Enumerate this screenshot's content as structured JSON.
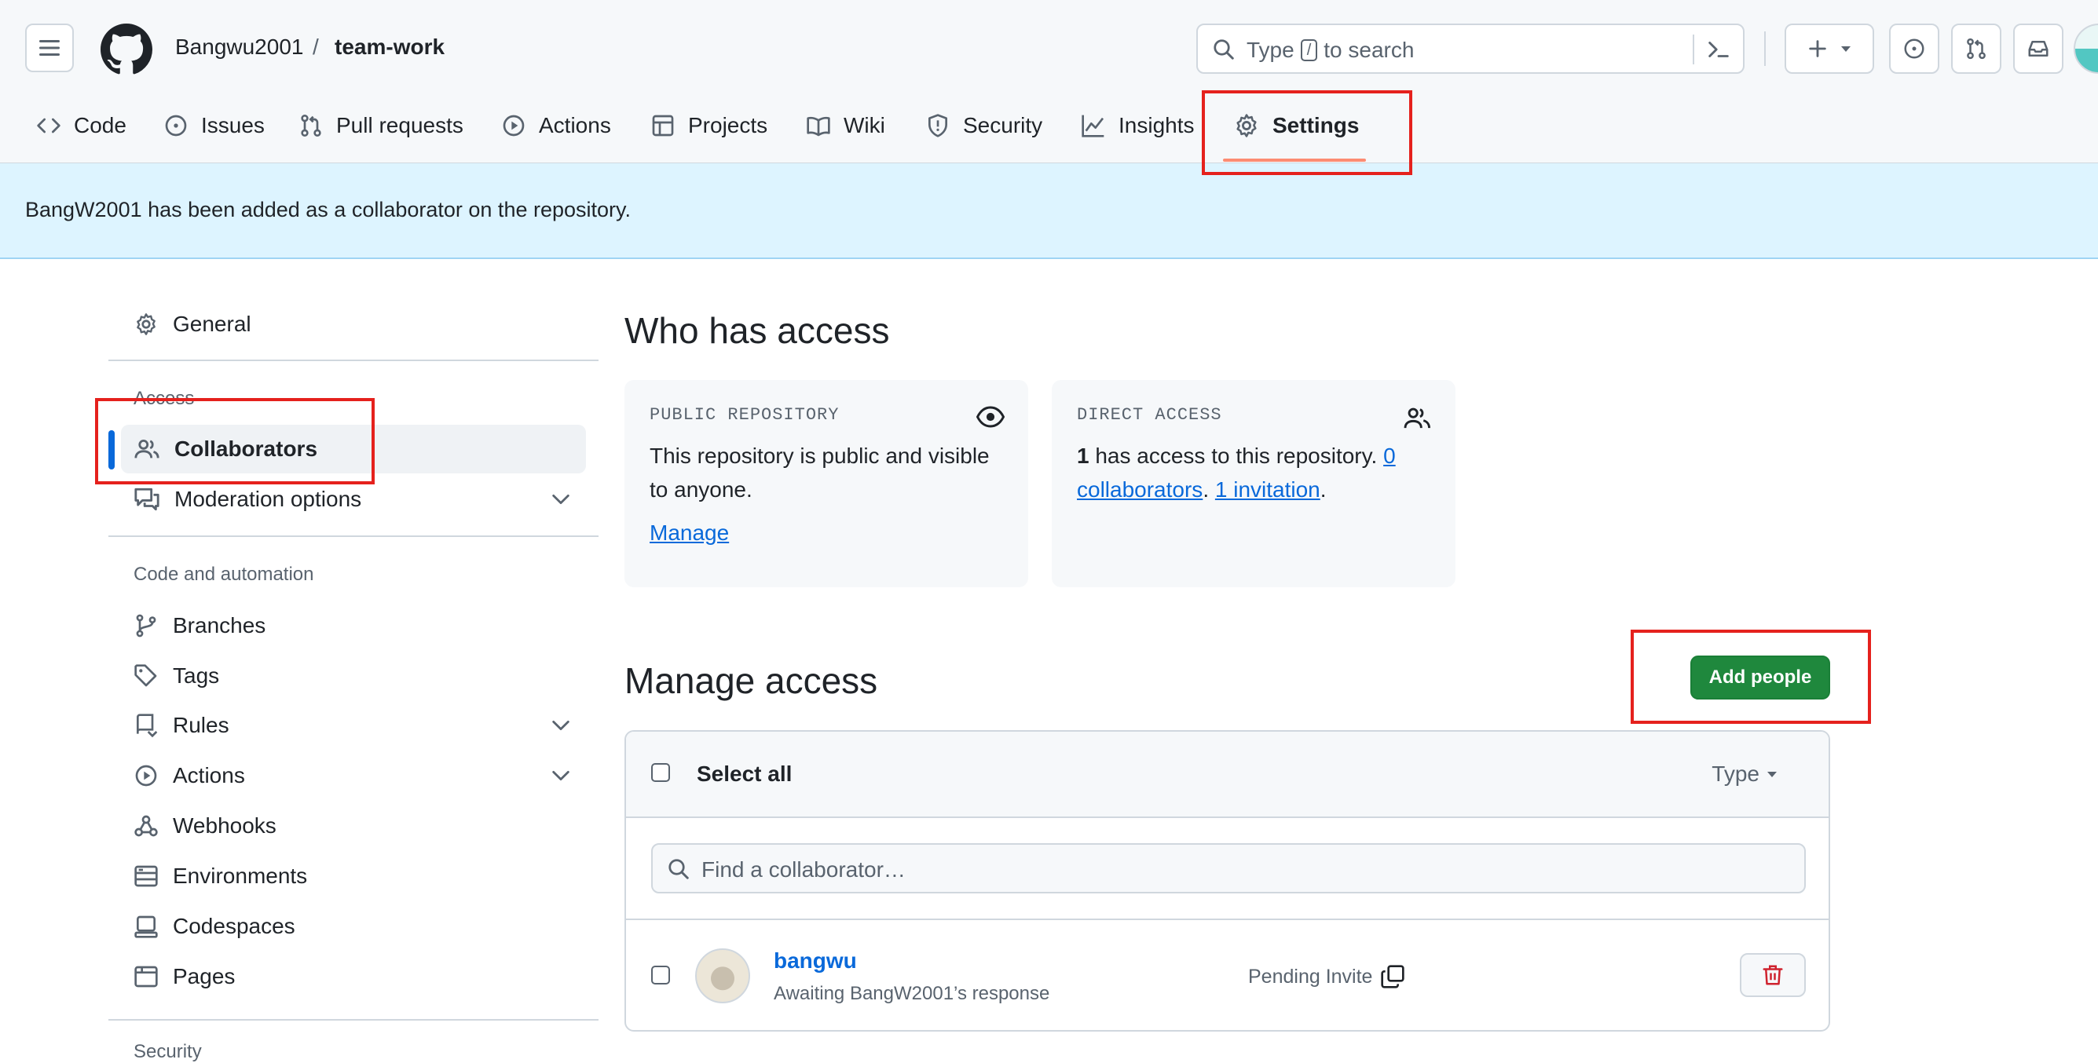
{
  "header": {
    "owner": "Bangwu2001",
    "separator": "/",
    "repo": "team-work",
    "search_prefix": "Type",
    "search_key": "/",
    "search_suffix": "to search"
  },
  "tabs": [
    {
      "label": "Code"
    },
    {
      "label": "Issues"
    },
    {
      "label": "Pull requests"
    },
    {
      "label": "Actions"
    },
    {
      "label": "Projects"
    },
    {
      "label": "Wiki"
    },
    {
      "label": "Security"
    },
    {
      "label": "Insights"
    },
    {
      "label": "Settings"
    }
  ],
  "flash": {
    "message": "BangW2001 has been added as a collaborator on the repository."
  },
  "sidebar": {
    "general": "General",
    "access_heading": "Access",
    "collaborators": "Collaborators",
    "moderation": "Moderation options",
    "code_heading": "Code and automation",
    "branches": "Branches",
    "tags": "Tags",
    "rules": "Rules",
    "actions": "Actions",
    "webhooks": "Webhooks",
    "environments": "Environments",
    "codespaces": "Codespaces",
    "pages": "Pages",
    "security_heading": "Security"
  },
  "who": {
    "title": "Who has access",
    "public_label": "PUBLIC REPOSITORY",
    "public_text": "This repository is public and visible to anyone.",
    "manage_link": "Manage",
    "direct_label": "DIRECT ACCESS",
    "direct_count": "1",
    "direct_text": " has access to this repository. ",
    "collaborators_link": "0 collaborators",
    "dot1": ". ",
    "invitation_link": "1 invitation",
    "dot2": "."
  },
  "manage": {
    "title": "Manage access",
    "add_button": "Add people",
    "select_all": "Select all",
    "type_filter": "Type",
    "find_placeholder": "Find a collaborator…"
  },
  "collaborators": [
    {
      "name": "bangwu",
      "sub": "Awaiting BangW2001’s response",
      "status": "Pending Invite"
    }
  ],
  "colors": {
    "accent": "#0969da",
    "primary_button": "#1f883d",
    "highlight": "#e5211d",
    "flash_bg": "#ddf4ff"
  }
}
